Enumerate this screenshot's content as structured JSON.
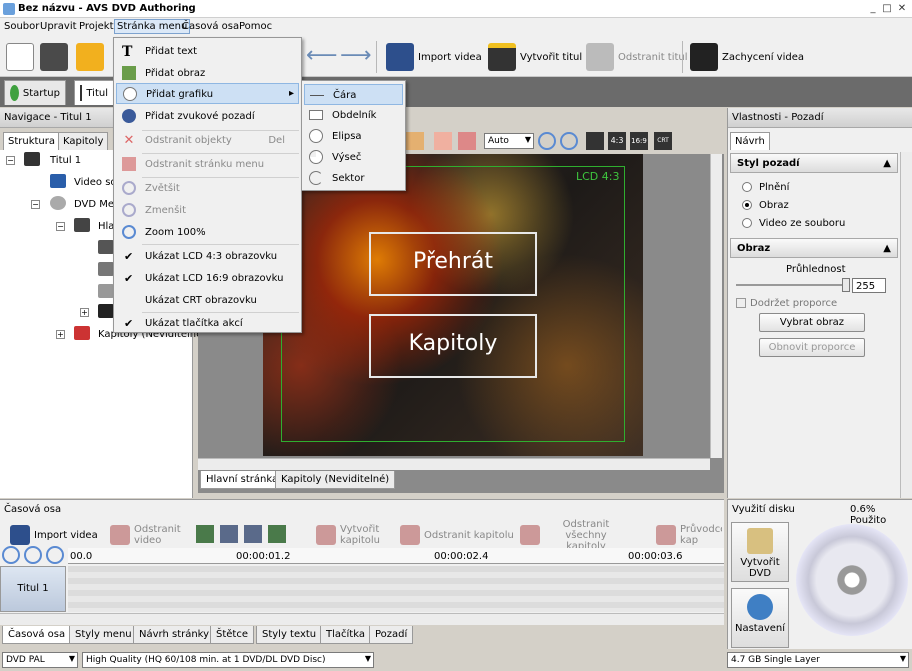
{
  "window": {
    "title": "Bez názvu - AVS DVD Authoring",
    "controls": [
      "_",
      "□",
      "✕"
    ]
  },
  "menubar": [
    "Soubor",
    "Upravit",
    "Projekt",
    "Stránka menu",
    "Časová osa",
    "Pomoc"
  ],
  "toolbar": {
    "import_video": "Import videa",
    "create_title": "Vytvořit titul",
    "delete_title": "Odstranit titul",
    "capture_video": "Zachycení videa"
  },
  "maintabs": {
    "startup": "Startup",
    "title": "Titul"
  },
  "navigation": {
    "header": "Navigace - Titul 1",
    "tabs": [
      "Struktura",
      "Kapitoly"
    ],
    "tree": [
      "Titul 1",
      "Video sou",
      "DVD Menu",
      "Hla",
      "Kapitoly (Neviditelné)"
    ]
  },
  "menu_dropdown": {
    "items": [
      {
        "label": "Přidat text",
        "icon": "text-icon"
      },
      {
        "label": "Přidat obraz",
        "icon": "image-icon"
      },
      {
        "label": "Přidat grafiku",
        "icon": "graphics-icon",
        "submenu_arrow": "▸"
      },
      {
        "label": "Přidat zvukové pozadí",
        "icon": "sound-icon"
      },
      {
        "label": "Odstranit objekty",
        "shortcut": "Del",
        "icon": "delete-icon"
      },
      {
        "label": "Odstranit stránku menu",
        "icon": "delete-page-icon"
      },
      {
        "label": "Zvětšit",
        "icon": "zoom-in-icon"
      },
      {
        "label": "Zmenšit",
        "icon": "zoom-out-icon"
      },
      {
        "label": "Zoom 100%",
        "icon": "zoom-100-icon"
      },
      {
        "label": "Ukázat LCD 4:3 obrazovku",
        "check": "✔"
      },
      {
        "label": "Ukázat LCD 16:9 obrazovku",
        "check": "✔"
      },
      {
        "label": "Ukázat CRT obrazovku"
      },
      {
        "label": "Ukázat tlačítka akcí",
        "check": "✔"
      }
    ]
  },
  "graphics_submenu": [
    "Čára",
    "Obdelník",
    "Elipsa",
    "Výseč",
    "Sektor"
  ],
  "canvas": {
    "zoom": "Auto",
    "aspect_labels": [
      "4:3",
      "16:9",
      "CRT"
    ],
    "lcd_label": "LCD 4:3",
    "buttons": [
      "Přehrát",
      "Kapitoly"
    ],
    "page_tabs": [
      "Hlavní stránka",
      "Kapitoly (Neviditelné)"
    ]
  },
  "properties": {
    "header": "Vlastnosti - Pozadí",
    "tab": "Návrh",
    "style_section": "Styl pozadí",
    "style_options": [
      "Plnění",
      "Obraz",
      "Video ze souboru"
    ],
    "image_section": "Obraz",
    "transparency_label": "Průhlednost",
    "transparency_value": "255",
    "keep_proportions": "Dodržet proporce",
    "choose_image": "Vybrat obraz",
    "restore_proportions": "Obnovit proporce"
  },
  "timeline": {
    "header": "Časová osa",
    "buttons": [
      "Import videa",
      "Odstranit video",
      "Vytvořit kapitolu",
      "Odstranit kapitolu",
      "Odstranit všechny kapitoly",
      "Průvodce kap"
    ],
    "ruler": [
      "00.0",
      "00:00:01.2",
      "00:00:02.4",
      "00:00:03.6"
    ],
    "track_label": "Titul 1",
    "tabs": [
      "Časová osa",
      "Styly menu",
      "Návrh stránky",
      "Štětce",
      "Styly textu",
      "Tlačítka",
      "Pozadí"
    ]
  },
  "disk": {
    "header": "Využití disku",
    "usage": "0.6% Použito",
    "burn": "Vytvořit DVD",
    "settings": "Nastavení"
  },
  "statusbar": {
    "format": "DVD PAL",
    "quality": "High Quality (HQ 60/108 min. at 1 DVD/DL DVD Disc)",
    "disc": "4.7 GB Single Layer"
  }
}
